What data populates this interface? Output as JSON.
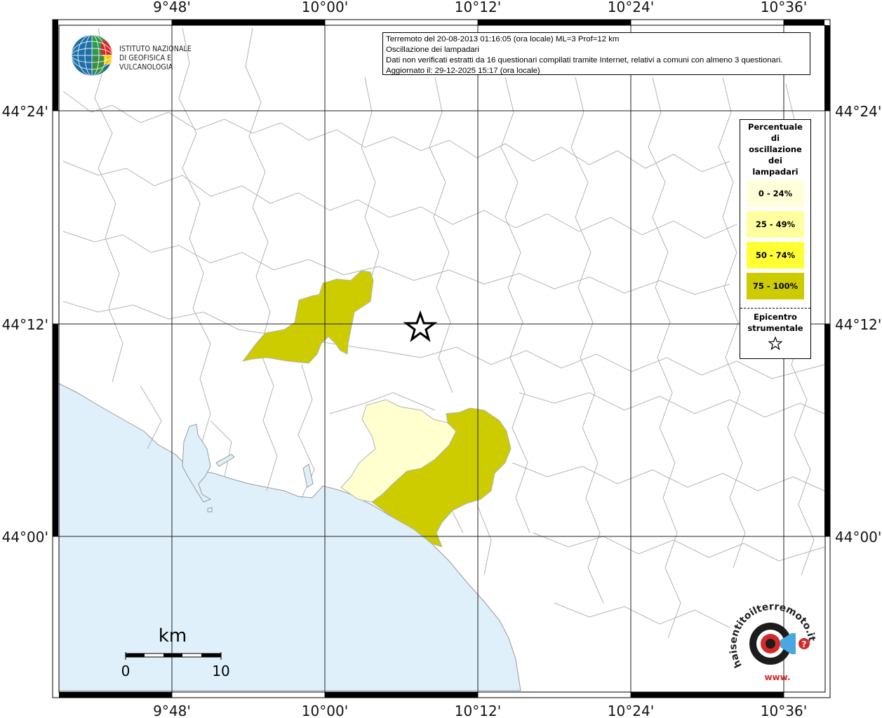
{
  "axes": {
    "top_lon": [
      "9°48'",
      "10°00'",
      "10°12'",
      "10°24'",
      "10°36'"
    ],
    "bottom_lon": [
      "9°48'",
      "10°00'",
      "10°12'",
      "10°24'",
      "10°36'"
    ],
    "left_lat": [
      "44°24'",
      "44°12'",
      "44°00'"
    ],
    "right_lat": [
      "44°24'",
      "44°12'",
      "44°00'"
    ]
  },
  "info": {
    "line1": "Terremoto del 20-08-2013 01:16:05 (ora locale) ML=3 Prof=12 km",
    "line2": "Oscillazione dei lampadari",
    "line3": "Dati non verificati estratti da 16 questionari compilati tramite Internet, relativi a comuni con almeno 3 questionari.",
    "line4": "Aggiornato il: 29-12-2025 15:17 (ora locale)"
  },
  "logo": {
    "line1": "ISTITUTO NAZIONALE",
    "line2": "DI GEOFISICA E VULCANOLOGIA"
  },
  "legend": {
    "title": [
      "Percentuale",
      "di",
      "oscillazione",
      "dei",
      "lampadari"
    ],
    "classes": [
      {
        "label": "0 - 24%",
        "color": "#ffffd9"
      },
      {
        "label": "25 - 49%",
        "color": "#ffffa0"
      },
      {
        "label": "50 - 74%",
        "color": "#ffff33"
      },
      {
        "label": "75 - 100%",
        "color": "#cccc00"
      }
    ],
    "epicenter_title": [
      "Epicentro",
      "strumentale"
    ]
  },
  "scale": {
    "title": "km",
    "start": "0",
    "end": "10"
  },
  "colors": {
    "sea": "#dff0fb",
    "boundary": "#b3b3b3",
    "grid": "#222222",
    "high_class": "#cccc00",
    "low_class": "#ffffd0"
  },
  "badge": {
    "text": "haisentitoilterremoto.it",
    "text2": "www."
  }
}
